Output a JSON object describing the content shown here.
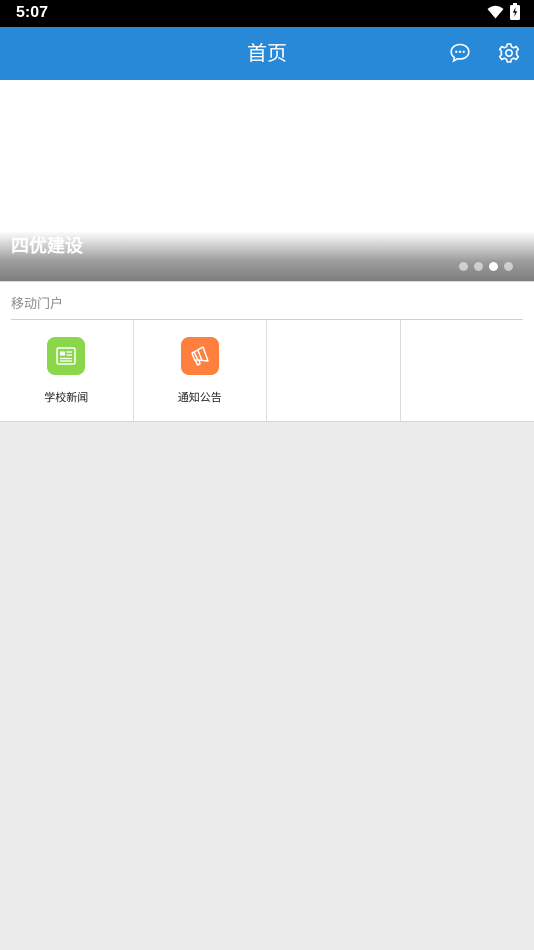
{
  "status_bar": {
    "time": "5:07",
    "icons": [
      "wifi-icon",
      "battery-charging-icon"
    ]
  },
  "app_bar": {
    "title": "首页",
    "actions": [
      "chat-icon",
      "settings-icon"
    ],
    "color": "#2789d8"
  },
  "banner": {
    "caption": "四优建设",
    "page_count": 4,
    "active_index": 2
  },
  "portal": {
    "title": "移动门户",
    "items": [
      {
        "label": "学校新闻",
        "icon": "news-icon",
        "color": "#8bd64a"
      },
      {
        "label": "通知公告",
        "icon": "megaphone-icon",
        "color": "#ff7f3f"
      },
      {
        "label": "",
        "icon": ""
      },
      {
        "label": "",
        "icon": ""
      }
    ]
  }
}
